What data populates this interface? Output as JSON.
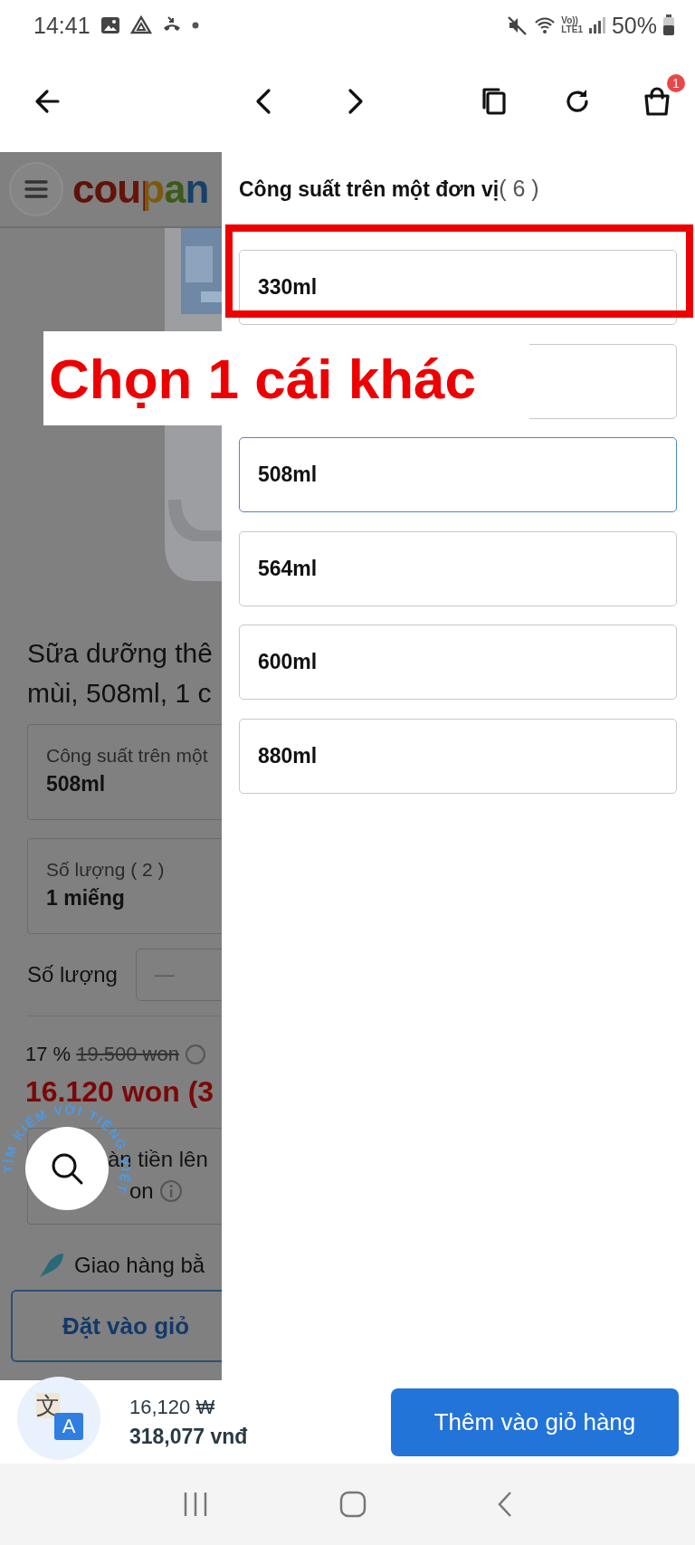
{
  "status_bar": {
    "time": "14:41",
    "volte": "Vo))",
    "network": "LTE1",
    "battery": "50%"
  },
  "toolbar": {
    "cart_badge": "1"
  },
  "background_page": {
    "logo": "coupan",
    "product_title_lines": [
      "Sữa dưỡng thê",
      "mùi, 508ml, 1 c"
    ],
    "option_cards": [
      {
        "label": "Công suất trên một",
        "value": "508ml"
      },
      {
        "label": "Số lượng ( 2 )",
        "value": "1 miếng"
      }
    ],
    "quantity_label": "Số lượng",
    "quantity_minus": "—",
    "discount": "17 %",
    "original_price": "19.500 won",
    "price": "16.120 won (3",
    "cashback_lines": [
      "àn tiền lên",
      "on"
    ],
    "delivery": "Giao hàng bằ",
    "cart_button": "Đặt vào giỏ"
  },
  "search_button": {
    "caption": "TÌM KIẾM VỚI TIẾNG VIỆT"
  },
  "option_panel": {
    "title": "Công suất trên một đơn vị",
    "count": "( 6 )",
    "options": [
      {
        "label": "330ml",
        "selected": false
      },
      {
        "selected": false
      },
      {
        "label": "508ml",
        "selected": true
      },
      {
        "label": "564ml",
        "selected": false
      },
      {
        "label": "600ml",
        "selected": false
      },
      {
        "label": "880ml",
        "selected": false
      }
    ]
  },
  "annotation": {
    "text": "Chọn 1 cái khác"
  },
  "bottom_bar": {
    "translate_glyphs": [
      "文",
      "A"
    ],
    "price_krw": "16,120 ₩",
    "price_vnd": "318,077 vnđ",
    "add_button": "Thêm vào giỏ hàng"
  }
}
